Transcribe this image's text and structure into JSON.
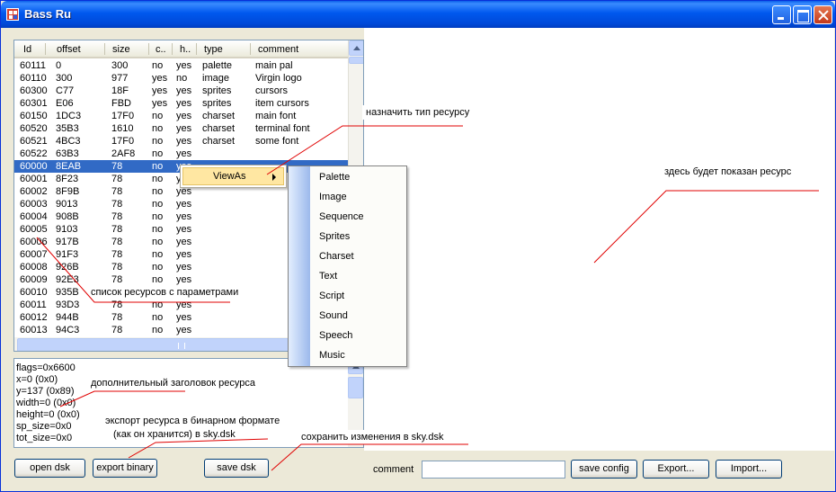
{
  "window": {
    "title": "Bass Ru"
  },
  "listview": {
    "columns": [
      "Id",
      "offset",
      "size",
      "c..",
      "h..",
      "type",
      "comment"
    ],
    "rows": [
      [
        "60111",
        "0",
        "300",
        "no",
        "yes",
        "palette",
        "main pal"
      ],
      [
        "60110",
        "300",
        "977",
        "yes",
        "no",
        "image",
        "Virgin logo"
      ],
      [
        "60300",
        "C77",
        "18F",
        "yes",
        "yes",
        "sprites",
        "cursors"
      ],
      [
        "60301",
        "E06",
        "FBD",
        "yes",
        "yes",
        "sprites",
        "item cursors"
      ],
      [
        "60150",
        "1DC3",
        "17F0",
        "no",
        "yes",
        "charset",
        "main font"
      ],
      [
        "60520",
        "35B3",
        "1610",
        "no",
        "yes",
        "charset",
        "terminal font"
      ],
      [
        "60521",
        "4BC3",
        "17F0",
        "no",
        "yes",
        "charset",
        "some font"
      ],
      [
        "60522",
        "63B3",
        "2AF8",
        "no",
        "yes",
        "",
        ""
      ],
      [
        "60000",
        "8EAB",
        "78",
        "no",
        "yes",
        "",
        ""
      ],
      [
        "60001",
        "8F23",
        "78",
        "no",
        "yes",
        "",
        ""
      ],
      [
        "60002",
        "8F9B",
        "78",
        "no",
        "yes",
        "",
        ""
      ],
      [
        "60003",
        "9013",
        "78",
        "no",
        "yes",
        "",
        ""
      ],
      [
        "60004",
        "908B",
        "78",
        "no",
        "yes",
        "",
        ""
      ],
      [
        "60005",
        "9103",
        "78",
        "no",
        "yes",
        "",
        ""
      ],
      [
        "60006",
        "917B",
        "78",
        "no",
        "yes",
        "",
        ""
      ],
      [
        "60007",
        "91F3",
        "78",
        "no",
        "yes",
        "",
        ""
      ],
      [
        "60008",
        "926B",
        "78",
        "no",
        "yes",
        "",
        ""
      ],
      [
        "60009",
        "92E3",
        "78",
        "no",
        "yes",
        "",
        ""
      ],
      [
        "60010",
        "935B",
        "78",
        "no",
        "yes",
        "",
        ""
      ],
      [
        "60011",
        "93D3",
        "78",
        "no",
        "yes",
        "",
        ""
      ],
      [
        "60012",
        "944B",
        "78",
        "no",
        "yes",
        "",
        ""
      ],
      [
        "60013",
        "94C3",
        "78",
        "no",
        "yes",
        "",
        ""
      ]
    ],
    "selected_row": 8
  },
  "header_text": [
    "flags=0x6600",
    "x=0 (0x0)",
    "y=137 (0x89)",
    "width=0 (0x0)",
    "height=0 (0x0)",
    "sp_size=0x0",
    "tot_size=0x0"
  ],
  "context_menu": {
    "item": "ViewAs"
  },
  "submenu": [
    "Palette",
    "Image",
    "Sequence",
    "Sprites",
    "Charset",
    "Text",
    "Script",
    "Sound",
    "Speech",
    "Music"
  ],
  "buttons": {
    "open_dsk": "open dsk",
    "export_binary": "export binary",
    "save_dsk": "save dsk",
    "save_config": "save config",
    "export": "Export...",
    "import": "Import..."
  },
  "comment": {
    "label": "comment",
    "value": ""
  },
  "annotations": {
    "assign_type": "назначить тип ресурсу",
    "resource_shown": "здесь будет показан ресурс",
    "resource_list": "список ресурсов с параметрами",
    "extra_header": "дополнительный заголовок ресурса",
    "export_binary_1": "экспорт ресурса в бинарном формате",
    "export_binary_2": "(как он хранится) в sky.dsk",
    "save_changes": "сохранить изменения в sky.dsk"
  },
  "colors": {
    "selection": "#316AC5",
    "titlebar": "#0058EE",
    "menu_highlight": "#FFE7A2",
    "annotation_line": "#E00000"
  }
}
